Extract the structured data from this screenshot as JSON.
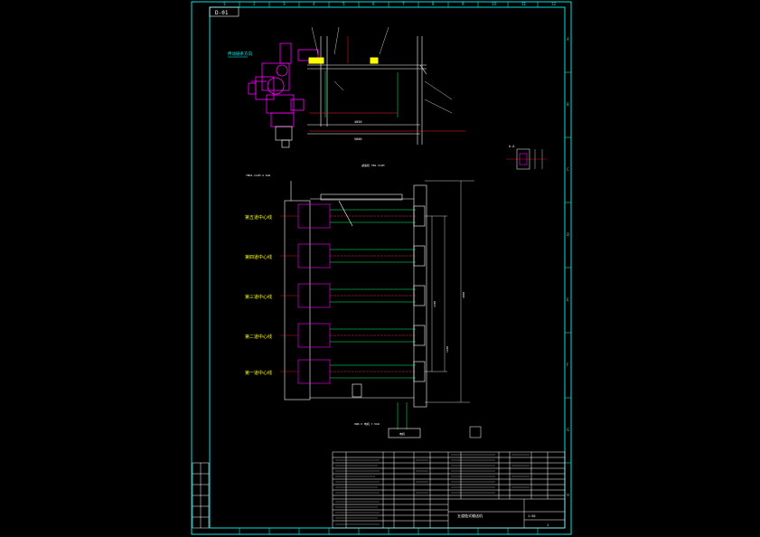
{
  "sheet": {
    "drawing_no": "D-01",
    "col_numbers": [
      "1",
      "2",
      "3",
      "4",
      "5",
      "6",
      "7",
      "8",
      "9",
      "10",
      "11",
      "12"
    ],
    "row_letters": [
      "A",
      "B",
      "C",
      "D",
      "E",
      "F",
      "G",
      "H"
    ]
  },
  "annotations": {
    "top_note": "传动链条方向",
    "plan_note_1": "YBK2-112M-4 4kW",
    "plan_note_2": "减速机 YB2-112M",
    "detail_label": "A-A",
    "motor_label": "电机",
    "bottom_note": "XWD-5 电机 7.5kW"
  },
  "centerlines": [
    {
      "label": "第五道中心线"
    },
    {
      "label": "第四道中心线"
    },
    {
      "label": "第三道中心线"
    },
    {
      "label": "第二道中心线"
    },
    {
      "label": "第一道中心线"
    }
  ],
  "dims": {
    "top_1": "4050",
    "top_2": "5000",
    "side_1": "1200",
    "side_2": "1200",
    "side_3": "4800"
  },
  "title_block": {
    "drawing_title": "五道链式输送机",
    "scale": "1:50",
    "sheet": "1"
  },
  "colors": {
    "line": "#ffffff",
    "accent": "#ff00ff",
    "green": "#00ff66",
    "cyan": "#00ffff",
    "red": "#ff2020",
    "yellow": "#ffff00",
    "frame": "#00e5e5"
  }
}
